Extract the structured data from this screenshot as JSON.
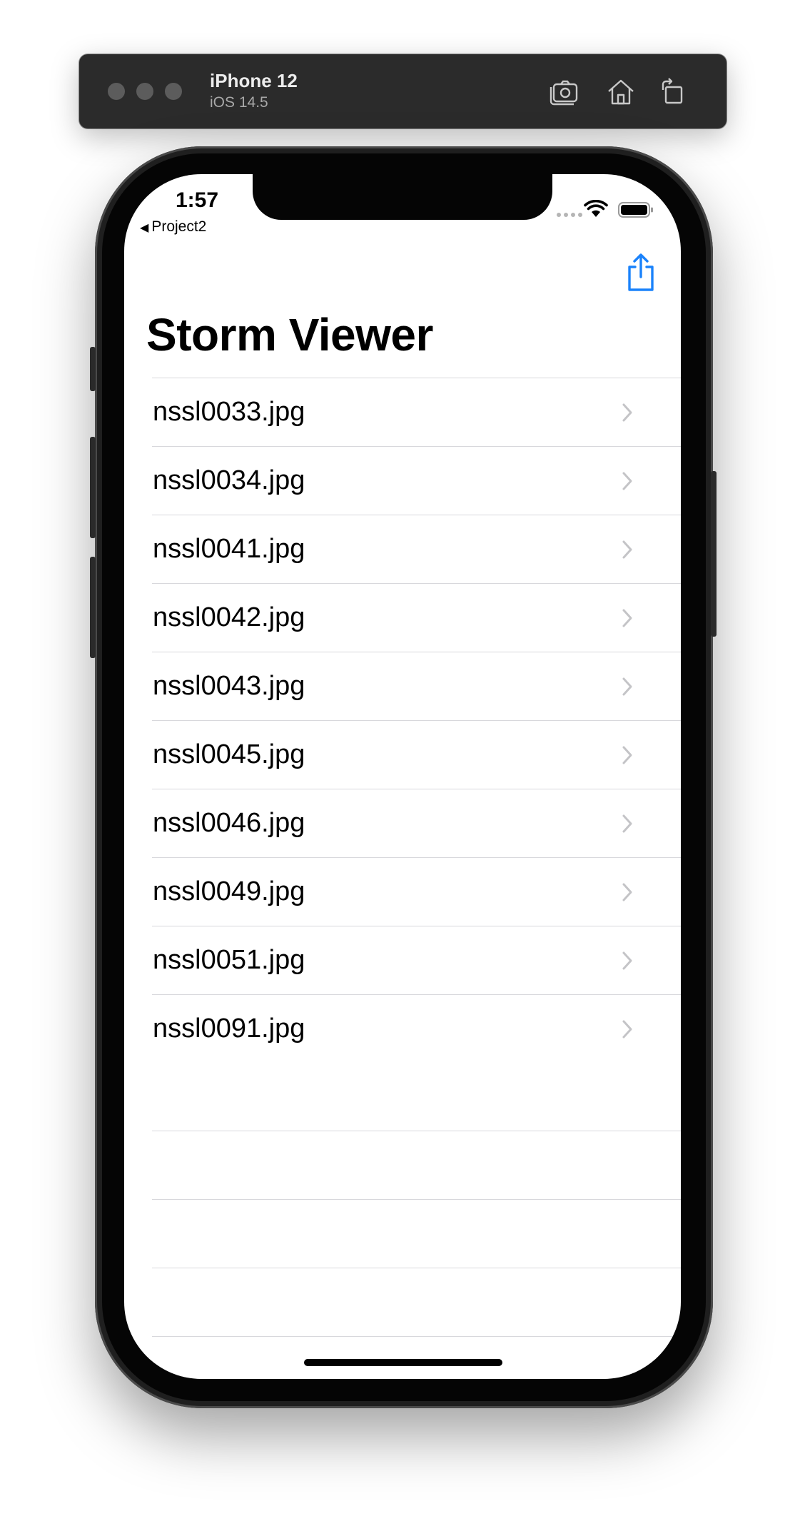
{
  "simulator": {
    "device_name": "iPhone 12",
    "os_version": "iOS 14.5",
    "icons": [
      "screenshot-icon",
      "home-icon",
      "rotate-icon"
    ]
  },
  "status_bar": {
    "time": "1:57",
    "back_app": "Project2",
    "back_glyph": "◀"
  },
  "nav": {
    "title": "Storm Viewer",
    "accent_color": "#1a82fb",
    "share_icon": "share-icon"
  },
  "list": {
    "items": [
      "nssl0033.jpg",
      "nssl0034.jpg",
      "nssl0041.jpg",
      "nssl0042.jpg",
      "nssl0043.jpg",
      "nssl0045.jpg",
      "nssl0046.jpg",
      "nssl0049.jpg",
      "nssl0051.jpg",
      "nssl0091.jpg"
    ],
    "disclosure_icon": "chevron-right-icon",
    "separator_color": "#d8d8dc"
  }
}
